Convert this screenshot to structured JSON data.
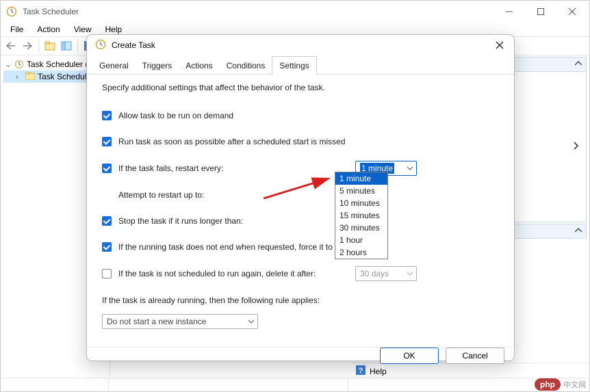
{
  "window": {
    "title": "Task Scheduler",
    "menu": {
      "file": "File",
      "action": "Action",
      "view": "View",
      "help": "Help"
    },
    "tree": {
      "root": "Task Scheduler (L",
      "child": "Task Scheduler"
    },
    "help": "Help"
  },
  "dialog": {
    "title": "Create Task",
    "tabs": {
      "general": "General",
      "triggers": "Triggers",
      "actions": "Actions",
      "conditions": "Conditions",
      "settings": "Settings"
    },
    "desc": "Specify additional settings that affect the behavior of the task.",
    "rows": {
      "allow_demand": "Allow task to be run on demand",
      "run_asap": "Run task as soon as possible after a scheduled start is missed",
      "fails_restart": "If the task fails, restart every:",
      "attempt": "Attempt to restart up to:",
      "stop_longer": "Stop the task if it runs longer than:",
      "force_stop": "If the running task does not end when requested, force it to sto",
      "delete_after": "If the task is not scheduled to run again, delete it after:",
      "already_running": "If the task is already running, then the following rule applies:"
    },
    "combos": {
      "restart_value": "1 minute",
      "delete_after_value": "30 days",
      "rule_value": "Do not start a new instance"
    },
    "dropdown_options": [
      "1 minute",
      "5 minutes",
      "10 minutes",
      "15 minutes",
      "30 minutes",
      "1 hour",
      "2 hours"
    ],
    "buttons": {
      "ok": "OK",
      "cancel": "Cancel"
    }
  },
  "watermark": {
    "badge": "php",
    "text": "中文网"
  }
}
